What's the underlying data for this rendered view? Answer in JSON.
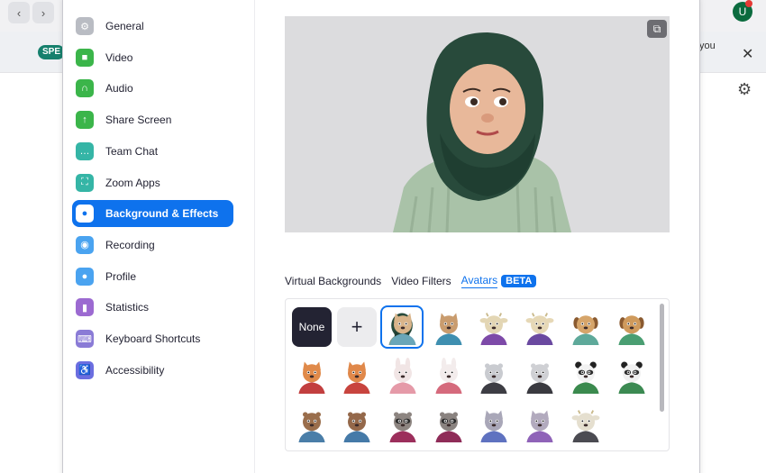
{
  "background_app": {
    "back_glyph": "‹",
    "forward_glyph": "›",
    "chip_label": "SPE",
    "avatar_initial": "U",
    "you_label": "you",
    "close_glyph": "✕",
    "gear_glyph": "⚙"
  },
  "sidebar": {
    "items": [
      {
        "label": "General",
        "icon": "gear-icon",
        "glyph": "⚙",
        "color": "#b9bcc3"
      },
      {
        "label": "Video",
        "icon": "video-camera-icon",
        "glyph": "■",
        "color": "#3bb54a"
      },
      {
        "label": "Audio",
        "icon": "headphones-icon",
        "glyph": "∩",
        "color": "#3bb54a"
      },
      {
        "label": "Share Screen",
        "icon": "share-screen-icon",
        "glyph": "↑",
        "color": "#3bb54a"
      },
      {
        "label": "Team Chat",
        "icon": "chat-bubble-icon",
        "glyph": "…",
        "color": "#35b5a6"
      },
      {
        "label": "Zoom Apps",
        "icon": "apps-icon",
        "glyph": "⛶",
        "color": "#35b5a6"
      },
      {
        "label": "Background & Effects",
        "icon": "person-frame-icon",
        "glyph": "●",
        "color": "#0e72ed",
        "active": true
      },
      {
        "label": "Recording",
        "icon": "record-icon",
        "glyph": "◉",
        "color": "#4aa3f0"
      },
      {
        "label": "Profile",
        "icon": "profile-icon",
        "glyph": "●",
        "color": "#4aa3f0"
      },
      {
        "label": "Statistics",
        "icon": "bar-chart-icon",
        "glyph": "▮",
        "color": "#9c6ad1"
      },
      {
        "label": "Keyboard Shortcuts",
        "icon": "keyboard-icon",
        "glyph": "⌨",
        "color": "#8a7bd6"
      },
      {
        "label": "Accessibility",
        "icon": "accessibility-icon",
        "glyph": "♿",
        "color": "#6b6ee0"
      }
    ]
  },
  "preview": {
    "mirror_glyph": "⧉"
  },
  "tabs": {
    "virtual_backgrounds": "Virtual Backgrounds",
    "video_filters": "Video Filters",
    "avatars": "Avatars",
    "beta": "BETA"
  },
  "avatars": {
    "none_label": "None",
    "add_glyph": "+",
    "items": [
      {
        "name": "avatar-person-hijab",
        "kind": "person",
        "fur": "#e8b89a",
        "shirt": "#7f9e86",
        "selected": true
      },
      {
        "name": "avatar-cat-tan",
        "kind": "cat",
        "fur": "#d9b48a",
        "shirt": "#6aa6b8"
      },
      {
        "name": "avatar-cat-brown",
        "kind": "cat",
        "fur": "#c99c6e",
        "shirt": "#3f8fb0"
      },
      {
        "name": "avatar-cow",
        "kind": "cow",
        "fur": "#e3d6b4",
        "shirt": "#7d4aa8"
      },
      {
        "name": "avatar-cow-2",
        "kind": "cow",
        "fur": "#e6d8b6",
        "shirt": "#6a49a0"
      },
      {
        "name": "avatar-dog-golden",
        "kind": "dog",
        "fur": "#d6a56a",
        "shirt": "#5ea99a"
      },
      {
        "name": "avatar-dog-tan",
        "kind": "dog",
        "fur": "#cf9a5c",
        "shirt": "#4a9e72"
      },
      {
        "name": "avatar-fox",
        "kind": "fox",
        "fur": "#e08a4a",
        "shirt": "#c23f3f"
      },
      {
        "name": "avatar-fox-2",
        "kind": "fox",
        "fur": "#e0884a",
        "shirt": "#c8443e"
      },
      {
        "name": "avatar-rabbit-pink",
        "kind": "rabbit",
        "fur": "#f1e5e5",
        "shirt": "#e59aa8"
      },
      {
        "name": "avatar-rabbit-white",
        "kind": "rabbit",
        "fur": "#f3ecec",
        "shirt": "#d56a7c"
      },
      {
        "name": "avatar-seal",
        "kind": "seal",
        "fur": "#c9cbd0",
        "shirt": "#3d3d44"
      },
      {
        "name": "avatar-seal-2",
        "kind": "seal",
        "fur": "#cfd0d4",
        "shirt": "#3a3a40"
      },
      {
        "name": "avatar-panda",
        "kind": "panda",
        "fur": "#f2f2f2",
        "shirt": "#3b8a4e"
      },
      {
        "name": "avatar-panda-2",
        "kind": "panda",
        "fur": "#f0f0f0",
        "shirt": "#3c8a52"
      },
      {
        "name": "avatar-otter",
        "kind": "otter",
        "fur": "#9a6e4c",
        "shirt": "#4a7ea8"
      },
      {
        "name": "avatar-otter-2",
        "kind": "otter",
        "fur": "#94684a",
        "shirt": "#457aa8"
      },
      {
        "name": "avatar-raccoon",
        "kind": "raccoon",
        "fur": "#8d8581",
        "shirt": "#9c2f5c"
      },
      {
        "name": "avatar-raccoon-2",
        "kind": "raccoon",
        "fur": "#8a8380",
        "shirt": "#8f2c58"
      },
      {
        "name": "avatar-cat-grey",
        "kind": "cat",
        "fur": "#a9a7b8",
        "shirt": "#5f72c0"
      },
      {
        "name": "avatar-cat-grey-2",
        "kind": "cat",
        "fur": "#b2aabe",
        "shirt": "#8f63b8"
      },
      {
        "name": "avatar-cow-dark",
        "kind": "cow",
        "fur": "#e5dfcf",
        "shirt": "#4b4b52"
      }
    ]
  }
}
